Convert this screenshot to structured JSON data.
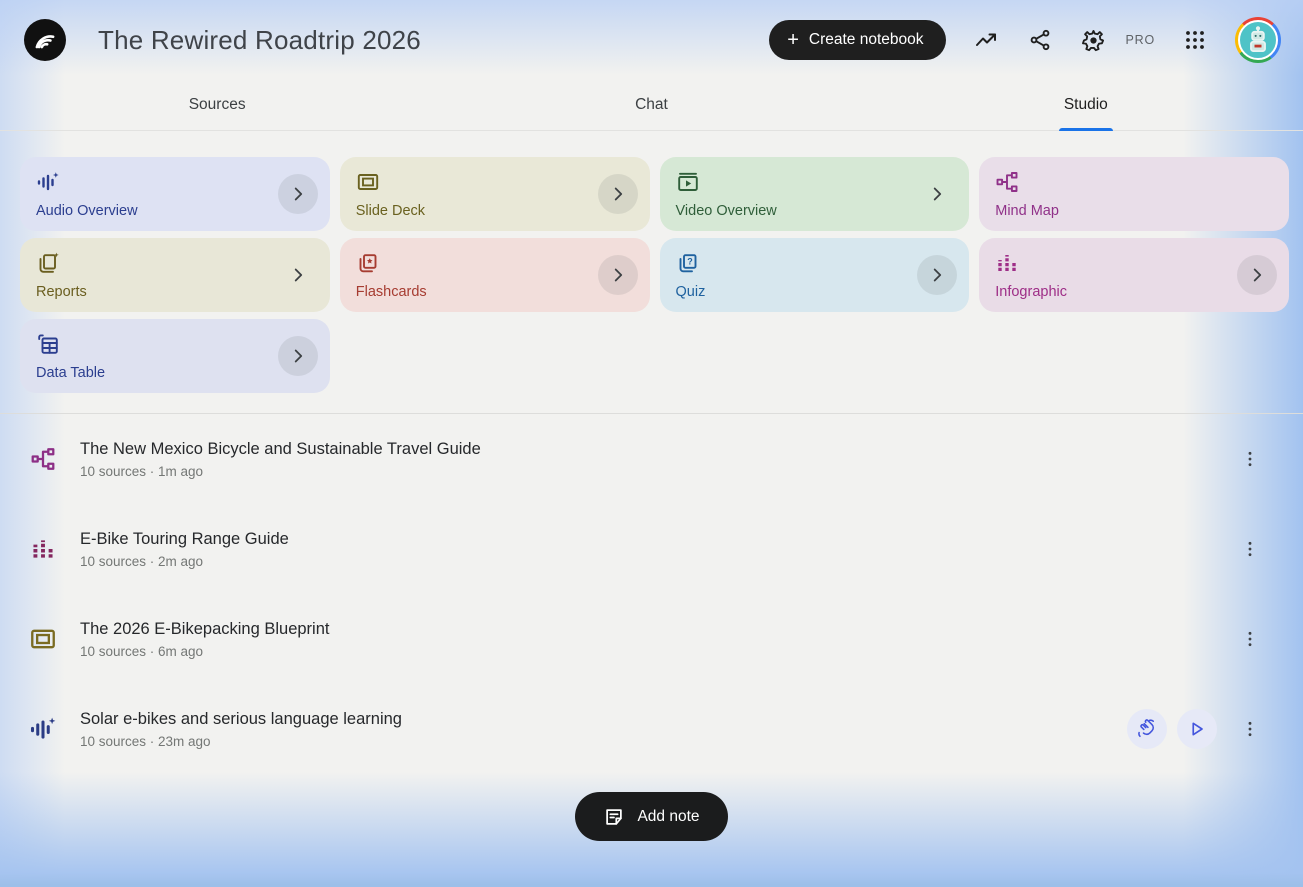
{
  "header": {
    "title": "The Rewired Roadtrip 2026",
    "create_notebook_label": "Create notebook",
    "plus_glyph": "+",
    "pro_label": "PRO"
  },
  "tabs": [
    {
      "label": "Sources",
      "active": false
    },
    {
      "label": "Chat",
      "active": false
    },
    {
      "label": "Studio",
      "active": true
    }
  ],
  "colors": {
    "accent_blue": "#1a73e8",
    "pill_black": "#1f1f1f",
    "audio_card_bg": "#dee2f3",
    "audio_card_fg": "#2b3e8f",
    "slide_card_bg": "#e9e8d7",
    "slide_card_fg": "#6a611f",
    "video_card_bg": "#d6e8d5",
    "video_card_fg": "#2f5e39",
    "mindmap_card_bg": "#e9dee9",
    "mindmap_card_fg": "#903189",
    "reports_card_bg": "#e8e7d7",
    "reports_card_fg": "#6a5e1f",
    "flashcards_card_bg": "#f2dedb",
    "flashcards_card_fg": "#a63c31",
    "quiz_card_bg": "#d7e7ee",
    "quiz_card_fg": "#1f629f",
    "infographic_card_bg": "#e9dce7",
    "infographic_card_fg": "#9e2e87",
    "datatable_card_bg": "#dee1f0",
    "datatable_card_fg": "#2b3e8f"
  },
  "studio": {
    "cards": [
      {
        "label": "Audio Overview",
        "icon": "audio-waveform-sparkle-icon",
        "chevron": "circle"
      },
      {
        "label": "Slide Deck",
        "icon": "slide-frame-icon",
        "chevron": "circle"
      },
      {
        "label": "Video Overview",
        "icon": "video-player-icon",
        "chevron": "plain"
      },
      {
        "label": "Mind Map",
        "icon": "mind-map-nodes-icon",
        "chevron": "none"
      },
      {
        "label": "Reports",
        "icon": "report-doc-sparkle-icon",
        "chevron": "plain"
      },
      {
        "label": "Flashcards",
        "icon": "card-star-icon",
        "chevron": "circle"
      },
      {
        "label": "Quiz",
        "icon": "card-question-icon",
        "chevron": "circle"
      },
      {
        "label": "Infographic",
        "icon": "bar-chart-icon",
        "chevron": "circle"
      },
      {
        "label": "Data Table",
        "icon": "table-grid-icon",
        "chevron": "circle"
      }
    ]
  },
  "artifacts": [
    {
      "title": "The New Mexico Bicycle and Sustainable Travel Guide",
      "meta": "10 sources · 1m ago",
      "icon": "mind-map-nodes-icon"
    },
    {
      "title": "E-Bike Touring Range Guide",
      "meta": "10 sources · 2m ago",
      "icon": "bar-chart-icon"
    },
    {
      "title": "The 2026 E-Bikepacking Blueprint",
      "meta": "10 sources · 6m ago",
      "icon": "slide-frame-icon"
    },
    {
      "title": "Solar e-bikes and serious language learning",
      "meta": "10 sources · 23m ago",
      "icon": "audio-waveform-sparkle-icon",
      "actions": [
        "interactive-mode",
        "play"
      ]
    }
  ],
  "footer": {
    "add_note_label": "Add note"
  }
}
